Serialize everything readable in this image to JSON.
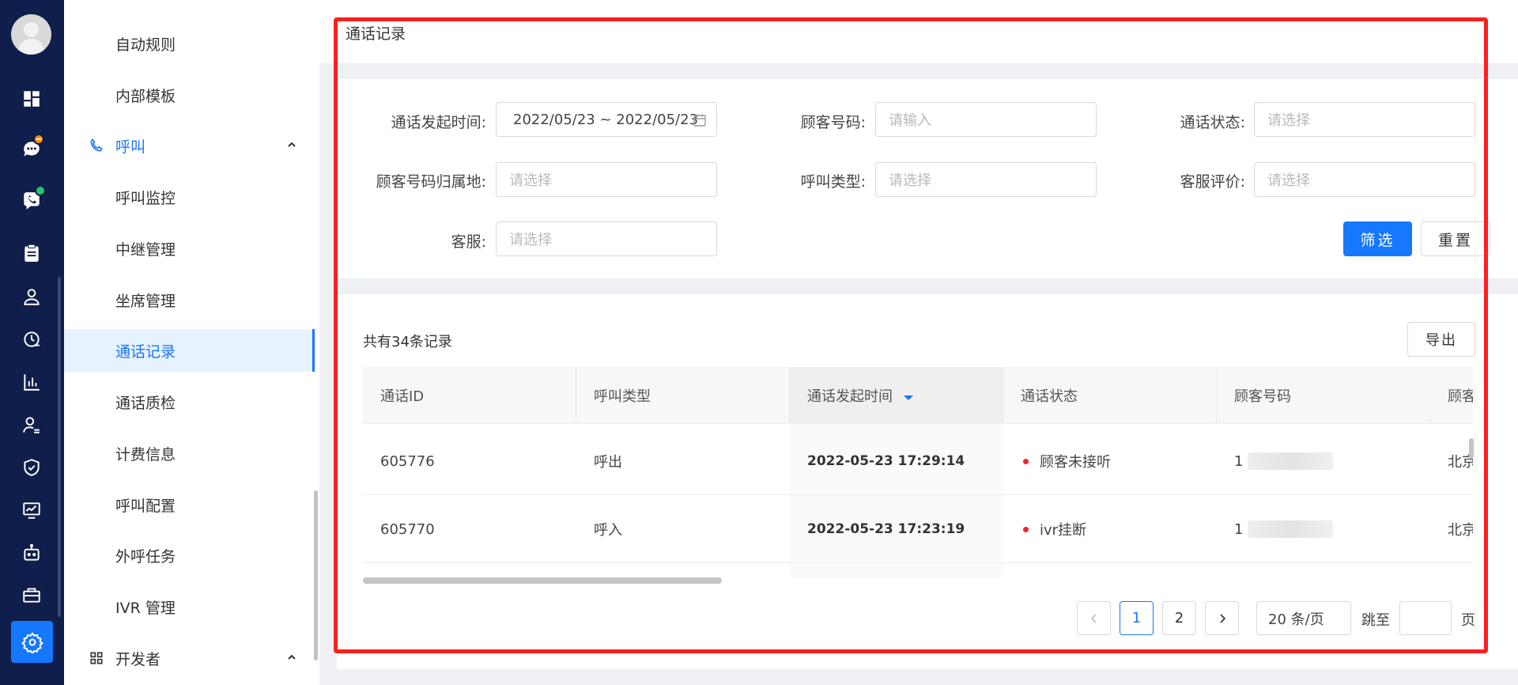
{
  "sidebar": {
    "items": [
      {
        "label": "自动规则"
      },
      {
        "label": "内部模板"
      },
      {
        "label": "呼叫"
      },
      {
        "label": "呼叫监控"
      },
      {
        "label": "中继管理"
      },
      {
        "label": "坐席管理"
      },
      {
        "label": "通话记录"
      },
      {
        "label": "通话质检"
      },
      {
        "label": "计费信息"
      },
      {
        "label": "呼叫配置"
      },
      {
        "label": "外呼任务"
      },
      {
        "label": "IVR 管理"
      },
      {
        "label": "开发者"
      }
    ],
    "active_item": "通话记录"
  },
  "page": {
    "title": "通话记录"
  },
  "filters": {
    "call_time": {
      "label": "通话发起时间:",
      "value": "2022/05/23 ~ 2022/05/23"
    },
    "customer_number": {
      "label": "顾客号码:",
      "placeholder": "请输入"
    },
    "call_status": {
      "label": "通话状态:",
      "placeholder": "请选择"
    },
    "number_location": {
      "label": "顾客号码归属地:",
      "placeholder": "请选择"
    },
    "call_type": {
      "label": "呼叫类型:",
      "placeholder": "请选择"
    },
    "agent_rating": {
      "label": "客服评价:",
      "placeholder": "请选择"
    },
    "agent": {
      "label": "客服:",
      "placeholder": "请选择"
    },
    "filter_button": "筛选",
    "reset_button": "重置"
  },
  "table": {
    "total_text": "共有34条记录",
    "export_button": "导出",
    "columns": [
      "通话ID",
      "呼叫类型",
      "通话发起时间",
      "通话状态",
      "顾客号码",
      "顾客"
    ],
    "rows": [
      {
        "id": "605776",
        "type": "呼出",
        "time": "2022-05-23 17:29:14",
        "status": "顾客未接听",
        "number": "1",
        "location": "北京"
      },
      {
        "id": "605770",
        "type": "呼入",
        "time": "2022-05-23 17:23:19",
        "status": "ivr挂断",
        "number": "1",
        "location": "北京"
      }
    ]
  },
  "pagination": {
    "prev": "<",
    "pages": [
      "1",
      "2"
    ],
    "current": "1",
    "next": ">",
    "page_size": "20 条/页",
    "jump_label": "跳至",
    "page_label": "页"
  },
  "colors": {
    "rail_bg": "#0f1e4a",
    "accent": "#1677ff",
    "highlight_border": "#ff1f1f",
    "status_dot": "#f5222d"
  }
}
